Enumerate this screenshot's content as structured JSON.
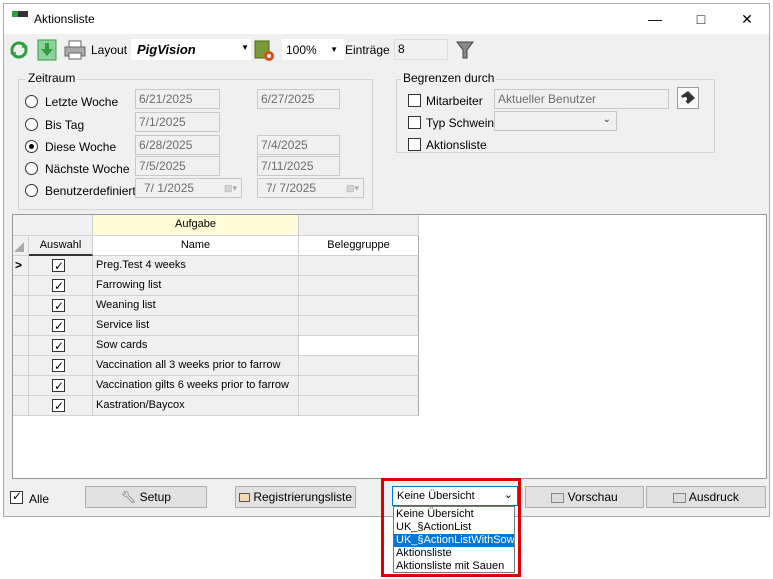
{
  "window": {
    "title": "Aktionsliste"
  },
  "toolbar": {
    "layout_label": "Layout",
    "layout_value": "PigVision",
    "zoom_value": "100%",
    "entries_label": "Einträge",
    "entries_value": "8"
  },
  "zeitraum": {
    "title": "Zeitraum",
    "rows": [
      {
        "label": "Letzte Woche",
        "from": "6/21/2025",
        "to": "6/27/2025",
        "selected": false
      },
      {
        "label": "Bis Tag",
        "from": "7/1/2025",
        "to": "",
        "selected": false
      },
      {
        "label": "Diese Woche",
        "from": "6/28/2025",
        "to": "7/4/2025",
        "selected": true
      },
      {
        "label": "Nächste Woche",
        "from": "7/5/2025",
        "to": "7/11/2025",
        "selected": false
      },
      {
        "label": "Benutzerdefiniert",
        "from": "7/  1/2025",
        "to": "7/  7/2025",
        "selected": false
      }
    ]
  },
  "begrenzen": {
    "title": "Begrenzen durch",
    "mitarbeiter_label": "Mitarbeiter",
    "mitarbeiter_value": "Aktueller Benutzer",
    "typ_label": "Typ Schwein",
    "aktionsliste_label": "Aktionsliste"
  },
  "grid": {
    "group_header": "Aufgabe",
    "col_auswahl": "Auswahl",
    "col_name": "Name",
    "col_beleggruppe": "Beleggruppe",
    "rows": [
      {
        "name": "Preg.Test 4 weeks",
        "checked": true
      },
      {
        "name": "Farrowing list",
        "checked": true
      },
      {
        "name": "Weaning list",
        "checked": true
      },
      {
        "name": "Service list",
        "checked": true
      },
      {
        "name": "Sow cards",
        "checked": true
      },
      {
        "name": "Vaccination all 3 weeks prior to farrow",
        "checked": true
      },
      {
        "name": "Vaccination gilts 6 weeks prior to farrow",
        "checked": true
      },
      {
        "name": "Kastration/Baycox",
        "checked": true
      }
    ]
  },
  "footer": {
    "alle_label": "Alle",
    "setup_label": "Setup",
    "registrierung_label": "Registrierungsliste",
    "overview_selected": "Keine Übersicht",
    "overview_options": [
      "Keine Übersicht",
      "UK_§ActionList",
      "UK_§ActionListWithSows",
      "Aktionsliste",
      "Aktionsliste mit Sauen"
    ],
    "overview_highlighted_index": 2,
    "vorschau_label": "Vorschau",
    "ausdruck_label": "Ausdruck"
  },
  "colors": {
    "highlight": "#0078d7",
    "callout_red": "#e00000",
    "grid_header_yellow": "#fffbd6"
  }
}
